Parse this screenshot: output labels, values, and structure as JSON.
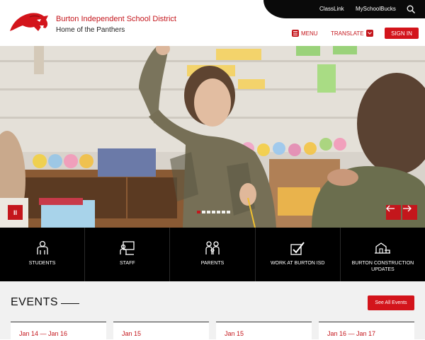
{
  "header": {
    "district_name": "Burton Independent School District",
    "tagline": "Home of the Panthers",
    "menu_label": "MENU",
    "translate_label": "TRANSLATE",
    "signin_label": "SIGN IN"
  },
  "topbar": {
    "links": [
      "ClassLink",
      "MySchoolBucks"
    ]
  },
  "hero": {
    "slide_count": 7,
    "active_slide": 1
  },
  "quicklinks": [
    {
      "label": "STUDENTS",
      "icon": "students-icon"
    },
    {
      "label": "STAFF",
      "icon": "staff-icon"
    },
    {
      "label": "PARENTS",
      "icon": "parents-icon"
    },
    {
      "label": "WORK AT BURTON ISD",
      "icon": "work-icon"
    },
    {
      "label": "BURTON CONSTRUCTION UPDATES",
      "icon": "construction-icon"
    }
  ],
  "events": {
    "title": "EVENTS",
    "see_all_label": "See All Events",
    "items": [
      {
        "date": "Jan 14 — Jan 16"
      },
      {
        "date": "Jan 15"
      },
      {
        "date": "Jan 15"
      },
      {
        "date": "Jan 16 — Jan 17"
      }
    ]
  },
  "colors": {
    "brand_red": "#c4161c",
    "topbar_black": "#0a0a0a",
    "events_bg": "#f1f1f1"
  }
}
